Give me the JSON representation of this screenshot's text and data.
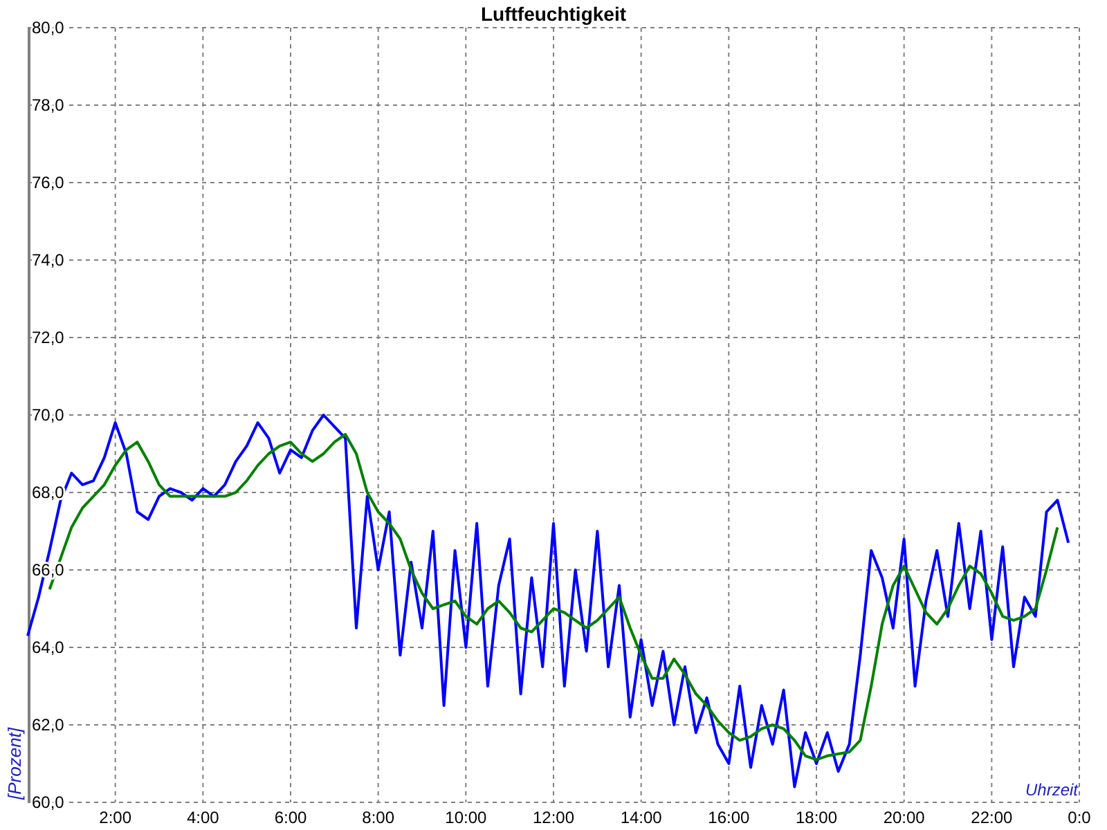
{
  "chart": {
    "chart_data": {
      "type": "line",
      "title": "Luftfeuchtigkeit",
      "xlabel": "Uhrzeit",
      "ylabel": "[Prozent]",
      "x": [
        0,
        0.25,
        0.5,
        0.75,
        1,
        1.25,
        1.5,
        1.75,
        2,
        2.25,
        2.5,
        2.75,
        3,
        3.25,
        3.5,
        3.75,
        4,
        4.25,
        4.5,
        4.75,
        5,
        5.25,
        5.5,
        5.75,
        6,
        6.25,
        6.5,
        6.75,
        7,
        7.25,
        7.5,
        7.75,
        8,
        8.25,
        8.5,
        8.75,
        9,
        9.25,
        9.5,
        9.75,
        10,
        10.25,
        10.5,
        10.75,
        11,
        11.25,
        11.5,
        11.75,
        12,
        12.25,
        12.5,
        12.75,
        13,
        13.25,
        13.5,
        13.75,
        14,
        14.25,
        14.5,
        14.75,
        15,
        15.25,
        15.5,
        15.75,
        16,
        16.25,
        16.5,
        16.75,
        17,
        17.25,
        17.5,
        17.75,
        18,
        18.25,
        18.5,
        18.75,
        19,
        19.25,
        19.5,
        19.75,
        20,
        20.25,
        20.5,
        20.75,
        21,
        21.25,
        21.5,
        21.75,
        22,
        22.25,
        22.5,
        22.75,
        23,
        23.25,
        23.5,
        23.75
      ],
      "series": [
        {
          "color": "#0000ff",
          "values": [
            64.3,
            65.3,
            66.5,
            67.8,
            68.5,
            68.2,
            68.3,
            68.9,
            69.8,
            69.0,
            67.5,
            67.3,
            67.9,
            68.1,
            68.0,
            67.8,
            68.1,
            67.9,
            68.2,
            68.8,
            69.2,
            69.8,
            69.4,
            68.5,
            69.1,
            68.9,
            69.6,
            70.0,
            69.7,
            69.4,
            64.5,
            67.9,
            66.0,
            67.5,
            63.8,
            66.2,
            64.5,
            67.0,
            62.5,
            66.5,
            64.0,
            67.2,
            63.0,
            65.6,
            66.8,
            62.8,
            65.8,
            63.5,
            67.2,
            63.0,
            66.0,
            63.9,
            67.0,
            63.5,
            65.6,
            62.2,
            64.2,
            62.5,
            63.9,
            62.0,
            63.5,
            61.8,
            62.7,
            61.5,
            61.0,
            63.0,
            60.9,
            62.5,
            61.5,
            62.9,
            60.4,
            61.8,
            61.0,
            61.8,
            60.8,
            61.5,
            63.8,
            66.5,
            65.8,
            64.5,
            66.8,
            63.0,
            65.2,
            66.5,
            64.8,
            67.2,
            65.0,
            67.0,
            64.2,
            66.6,
            63.5,
            65.3,
            64.8,
            67.5,
            67.8,
            66.7
          ]
        },
        {
          "color": "#008000",
          "values": [
            null,
            null,
            65.5,
            66.3,
            67.1,
            67.6,
            67.9,
            68.2,
            68.7,
            69.1,
            69.3,
            68.8,
            68.2,
            67.9,
            67.9,
            67.9,
            67.9,
            67.9,
            67.9,
            68.0,
            68.3,
            68.7,
            69.0,
            69.2,
            69.3,
            69.0,
            68.8,
            69.0,
            69.3,
            69.5,
            69.0,
            68.0,
            67.5,
            67.2,
            66.8,
            66.0,
            65.4,
            65.0,
            65.1,
            65.2,
            64.8,
            64.6,
            65.0,
            65.2,
            64.9,
            64.5,
            64.4,
            64.7,
            65.0,
            64.9,
            64.7,
            64.5,
            64.7,
            65.0,
            65.3,
            64.5,
            63.8,
            63.2,
            63.2,
            63.7,
            63.3,
            62.8,
            62.5,
            62.1,
            61.8,
            61.6,
            61.7,
            61.9,
            62.0,
            61.9,
            61.6,
            61.2,
            61.1,
            61.2,
            61.25,
            61.3,
            61.6,
            63.0,
            64.6,
            65.6,
            66.1,
            65.5,
            64.9,
            64.6,
            65.0,
            65.6,
            66.1,
            65.9,
            65.4,
            64.8,
            64.7,
            64.8,
            65.0,
            66.0,
            67.1,
            null
          ]
        }
      ],
      "grid": true,
      "xlim": [
        0,
        24
      ],
      "ylim": [
        60,
        80
      ],
      "xticks": [
        {
          "value": 2,
          "label": "2:00"
        },
        {
          "value": 4,
          "label": "4:00"
        },
        {
          "value": 6,
          "label": "6:00"
        },
        {
          "value": 8,
          "label": "8:00"
        },
        {
          "value": 10,
          "label": "10:00"
        },
        {
          "value": 12,
          "label": "12:00"
        },
        {
          "value": 14,
          "label": "14:00"
        },
        {
          "value": 16,
          "label": "16:00"
        },
        {
          "value": 18,
          "label": "18:00"
        },
        {
          "value": 20,
          "label": "20:00"
        },
        {
          "value": 22,
          "label": "22:00"
        },
        {
          "value": 24,
          "label": "0:0"
        }
      ],
      "yticks": [
        {
          "value": 60,
          "label": "60,0"
        },
        {
          "value": 62,
          "label": "62,0"
        },
        {
          "value": 64,
          "label": "64,0"
        },
        {
          "value": 66,
          "label": "66,0"
        },
        {
          "value": 68,
          "label": "68,0"
        },
        {
          "value": 70,
          "label": "70,0"
        },
        {
          "value": 72,
          "label": "72,0"
        },
        {
          "value": 74,
          "label": "74,0"
        },
        {
          "value": 76,
          "label": "76,0"
        },
        {
          "value": 78,
          "label": "78,0"
        },
        {
          "value": 80,
          "label": "80,0"
        }
      ]
    }
  }
}
